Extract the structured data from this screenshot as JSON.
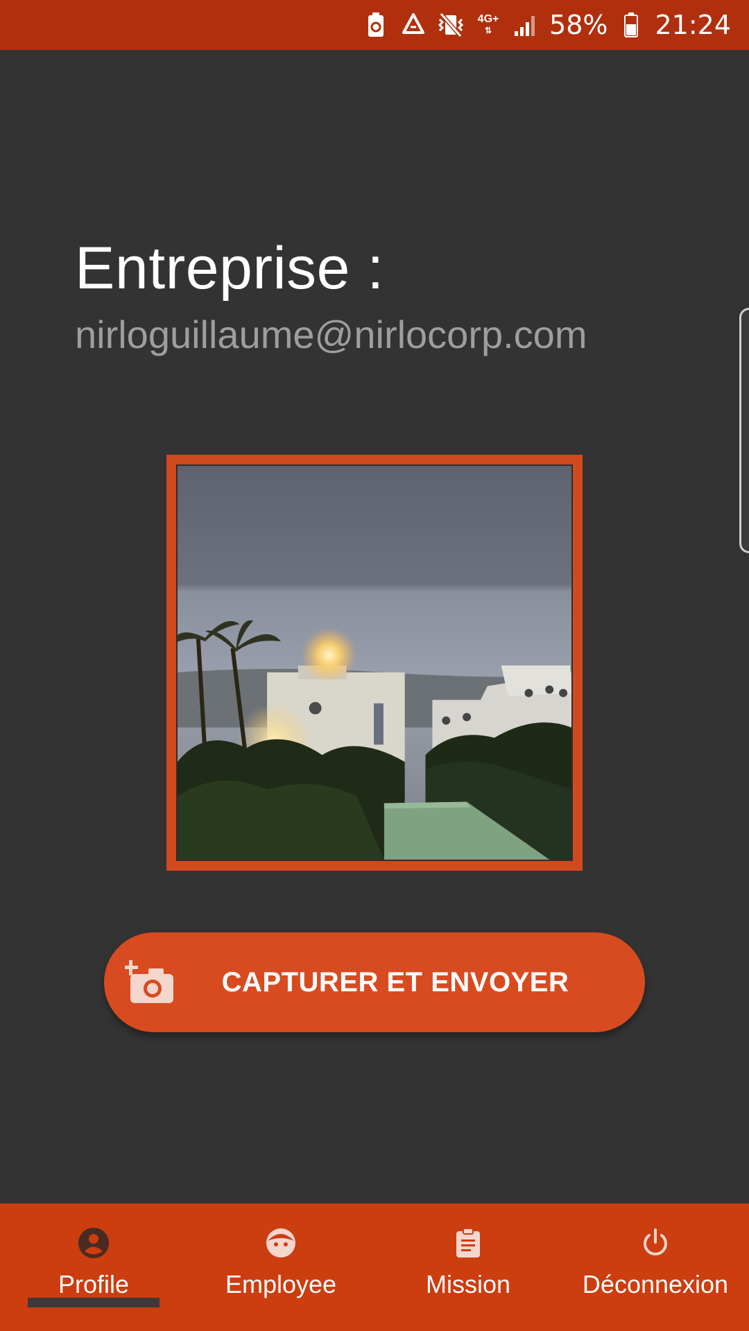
{
  "status_bar": {
    "battery_percent": "58%",
    "time": "21:24",
    "network_label": "4G+",
    "icons": [
      "battery-recycle-icon",
      "recycle-icon",
      "vibrate-off-icon",
      "network-4g-icon",
      "signal-icon",
      "battery-icon"
    ]
  },
  "profile": {
    "title": "Entreprise :",
    "email": "nirloguillaume@nirlocorp.com"
  },
  "photo": {
    "icon": "profile-photo"
  },
  "capture_button": {
    "label": "CAPTURER ET ENVOYER",
    "icon": "add-camera-icon"
  },
  "bottom_nav": {
    "items": [
      {
        "label": "Profile",
        "icon": "account-circle-icon",
        "active": true
      },
      {
        "label": "Employee",
        "icon": "face-icon",
        "active": false
      },
      {
        "label": "Mission",
        "icon": "clipboard-icon",
        "active": false
      },
      {
        "label": "Déconnexion",
        "icon": "power-icon",
        "active": false
      }
    ]
  },
  "colors": {
    "primary": "#CC3D10",
    "status_bar": "#B0300E",
    "accent": "#D84B20",
    "background": "#333333"
  }
}
